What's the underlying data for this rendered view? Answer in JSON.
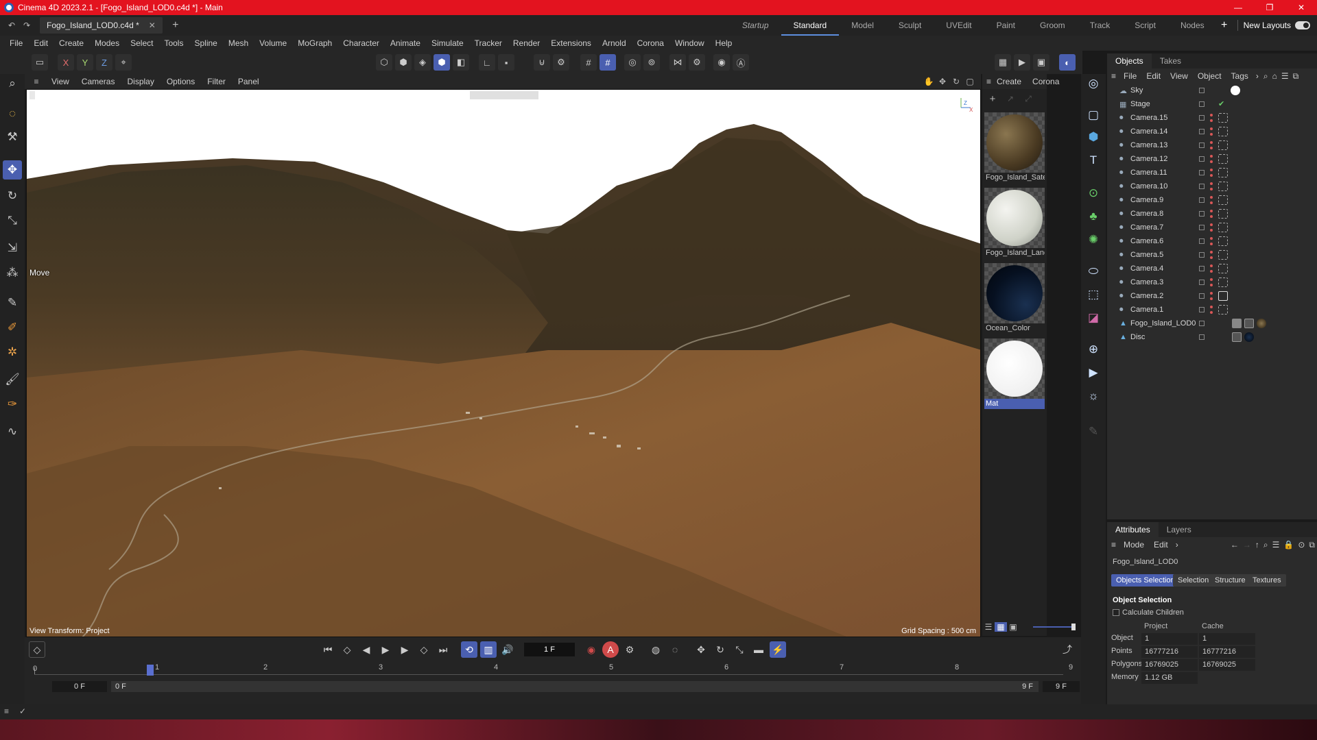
{
  "window": {
    "title": "Cinema 4D 2023.2.1 - [Fogo_Island_LOD0.c4d *] - Main"
  },
  "doc_tab": {
    "label": "Fogo_Island_LOD0.c4d *"
  },
  "layouts": {
    "items": [
      "Startup",
      "Standard",
      "Model",
      "Sculpt",
      "UVEdit",
      "Paint",
      "Groom",
      "Track",
      "Script",
      "Nodes"
    ],
    "new_layouts": "New Layouts"
  },
  "menubar": [
    "File",
    "Edit",
    "Create",
    "Modes",
    "Select",
    "Tools",
    "Spline",
    "Mesh",
    "Volume",
    "MoGraph",
    "Character",
    "Animate",
    "Simulate",
    "Tracker",
    "Render",
    "Extensions",
    "Arnold",
    "Corona",
    "Window",
    "Help"
  ],
  "axis_buttons": [
    "X",
    "Y",
    "Z"
  ],
  "viewport": {
    "menu": [
      "View",
      "Cameras",
      "Display",
      "Options",
      "Filter",
      "Panel"
    ],
    "move_label": "Move",
    "view_transform": "View Transform: Project",
    "grid_spacing": "Grid Spacing : 500 cm"
  },
  "materials": {
    "menu": [
      "Create",
      "Corona"
    ],
    "items": [
      "Fogo_Island_Satel",
      "Fogo_Island_Land",
      "Ocean_Color",
      "Mat"
    ]
  },
  "objects": {
    "tabs": [
      "Objects",
      "Takes"
    ],
    "menu": [
      "File",
      "Edit",
      "View",
      "Object",
      "Tags"
    ],
    "rows": [
      "Sky",
      "Stage",
      "Camera.15",
      "Camera.14",
      "Camera.13",
      "Camera.12",
      "Camera.11",
      "Camera.10",
      "Camera.9",
      "Camera.8",
      "Camera.7",
      "Camera.6",
      "Camera.5",
      "Camera.4",
      "Camera.3",
      "Camera.2",
      "Camera.1",
      "Fogo_Island_LOD0",
      "Disc"
    ]
  },
  "attributes": {
    "tabs": [
      "Attributes",
      "Layers"
    ],
    "menu": [
      "Mode",
      "Edit"
    ],
    "object_name": "Fogo_Island_LOD0",
    "chips": [
      "Objects Selection",
      "Selection",
      "Structure",
      "Textures"
    ],
    "section": "Object Selection",
    "calc_children": "Calculate Children",
    "col_project": "Project",
    "col_cache": "Cache",
    "rows": [
      {
        "label": "Object",
        "project": "1",
        "cache": "1"
      },
      {
        "label": "Points",
        "project": "16777216",
        "cache": "16777216"
      },
      {
        "label": "Polygons",
        "project": "16769025",
        "cache": "16769025"
      },
      {
        "label": "Memory",
        "project": "1.12 GB",
        "cache": ""
      }
    ]
  },
  "timeline": {
    "current_frame": "1 F",
    "start_field": "0 F",
    "range_start": "0 F",
    "range_end": "9 F",
    "end_field": "9 F",
    "ticks": [
      "0",
      "1",
      "2",
      "3",
      "4",
      "5",
      "6",
      "7",
      "8",
      "9"
    ]
  },
  "colors": {
    "accent": "#4a5fb0",
    "titlebar": "#e3131f"
  }
}
